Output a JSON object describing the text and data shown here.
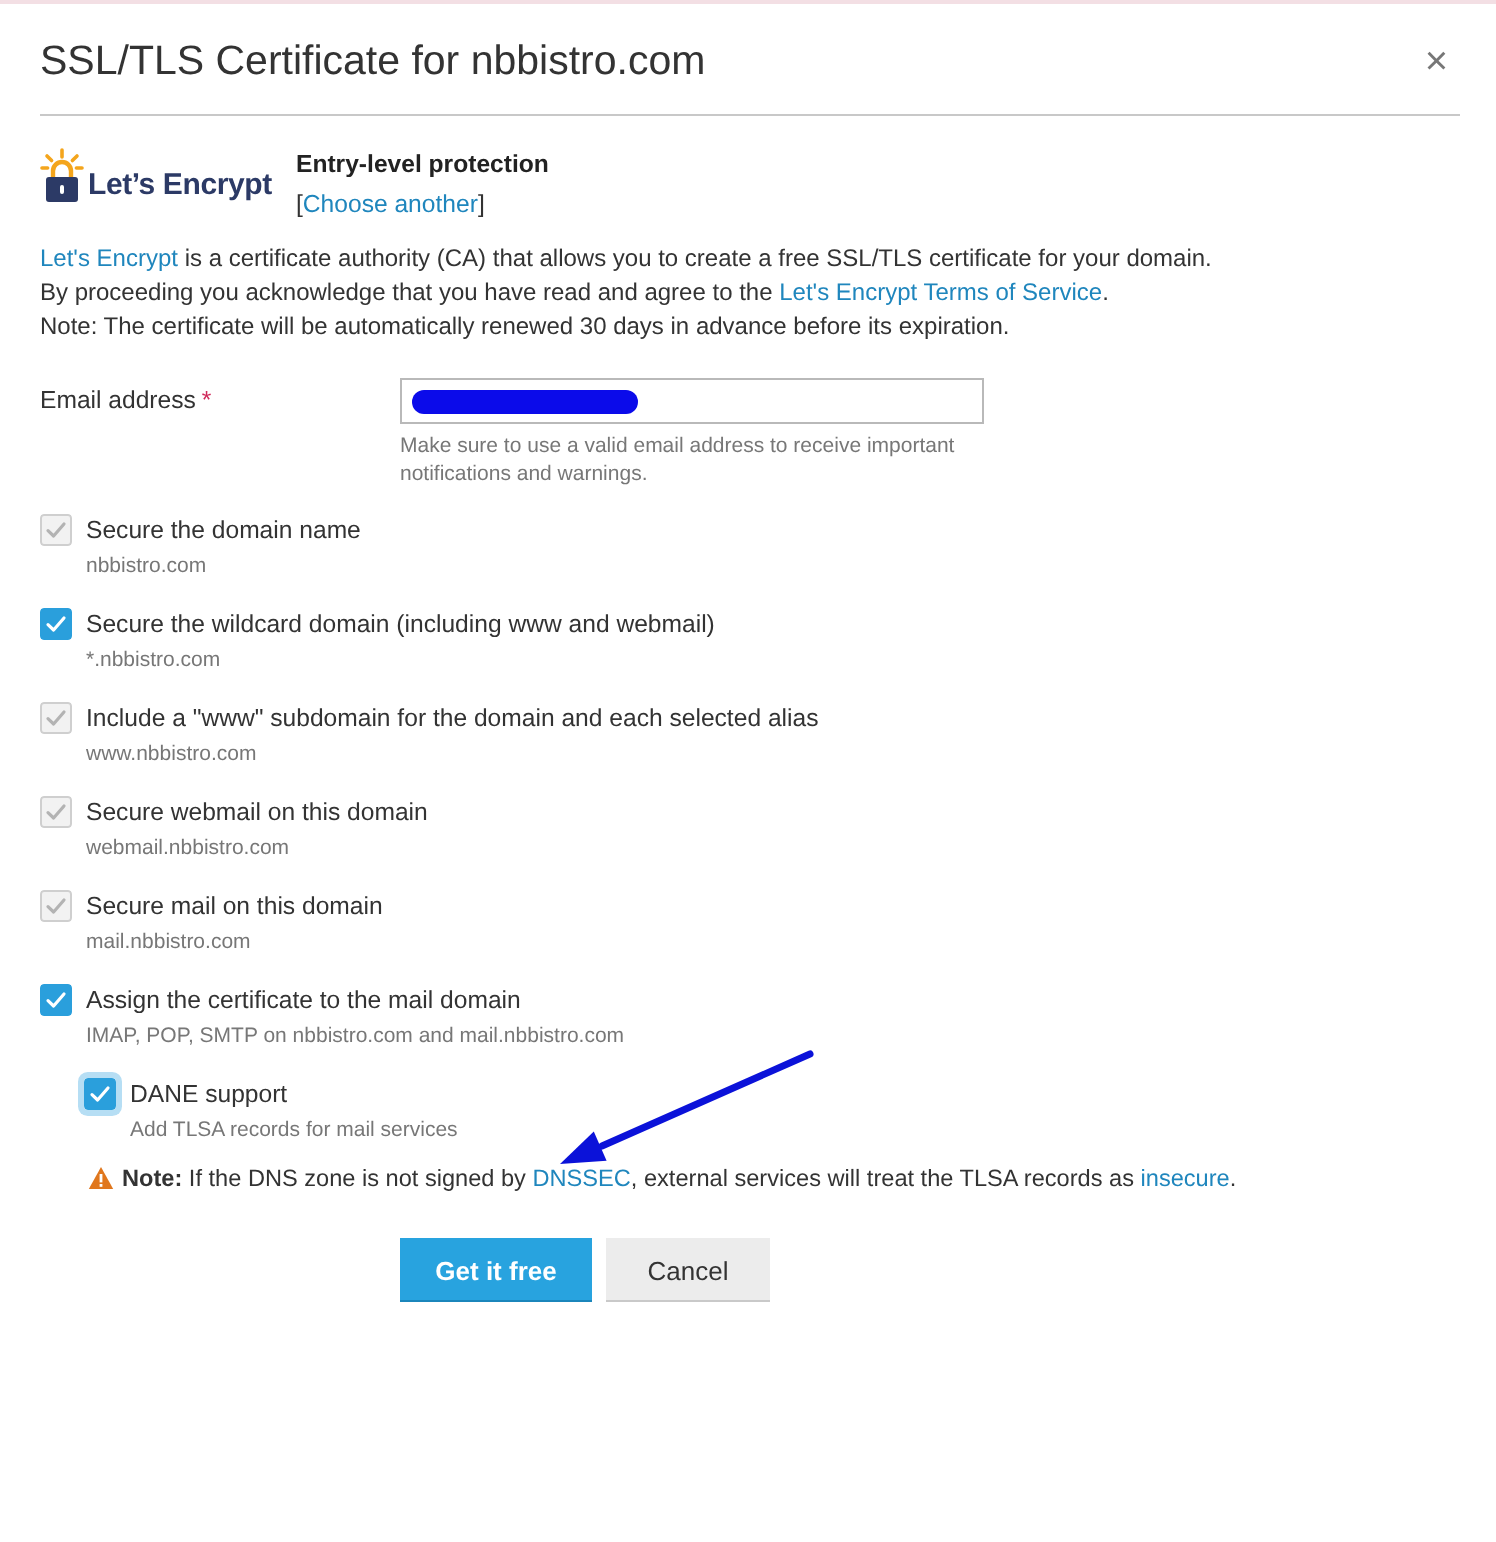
{
  "dialog": {
    "title": "SSL/TLS Certificate for nbbistro.com",
    "close": "×"
  },
  "provider": {
    "logo_text": "Let’s Encrypt",
    "tier": "Entry-level protection",
    "choose": [
      {
        "kind": "text",
        "text": "["
      },
      {
        "kind": "link",
        "text": "Choose another"
      },
      {
        "kind": "text",
        "text": "]"
      }
    ]
  },
  "intro": [
    [
      {
        "kind": "link",
        "text": "Let's Encrypt"
      },
      {
        "kind": "text",
        "text": " is a certificate authority (CA) that allows you to create a free SSL/TLS certificate for your domain."
      }
    ],
    [
      {
        "kind": "text",
        "text": "By proceeding you acknowledge that you have read and agree to the "
      },
      {
        "kind": "link",
        "text": "Let's Encrypt Terms of Service"
      },
      {
        "kind": "text",
        "text": "."
      }
    ],
    [
      {
        "kind": "text",
        "text": "Note: The certificate will be automatically renewed 30 days in advance before its expiration."
      }
    ]
  ],
  "email": {
    "label": "Email address",
    "required_mark": "*",
    "redacted": true,
    "hint": "Make sure to use a valid email address to receive important notifications and warnings."
  },
  "options": [
    {
      "kind": "checkbox",
      "label": "Secure the domain name",
      "hint": "nbbistro.com",
      "checked": true,
      "disabled": true,
      "focused": false
    },
    {
      "kind": "checkbox",
      "label": "Secure the wildcard domain (including www and webmail)",
      "hint": "*.nbbistro.com",
      "checked": true,
      "disabled": false,
      "focused": false
    },
    {
      "kind": "checkbox",
      "label": "Include a \"www\" subdomain for the domain and each selected alias",
      "hint": "www.nbbistro.com",
      "checked": true,
      "disabled": true,
      "focused": false
    },
    {
      "kind": "checkbox",
      "label": "Secure webmail on this domain",
      "hint": "webmail.nbbistro.com",
      "checked": true,
      "disabled": true,
      "focused": false
    },
    {
      "kind": "checkbox",
      "label": "Secure mail on this domain",
      "hint": "mail.nbbistro.com",
      "checked": true,
      "disabled": true,
      "focused": false
    },
    {
      "kind": "checkbox",
      "label": "Assign the certificate to the mail domain",
      "hint": "IMAP, POP, SMTP on nbbistro.com and mail.nbbistro.com",
      "checked": true,
      "disabled": false,
      "focused": false,
      "children": [
        {
          "kind": "checkbox",
          "label": "DANE support",
          "hint": "Add TLSA records for mail services",
          "checked": true,
          "disabled": false,
          "focused": true
        }
      ]
    }
  ],
  "note": [
    {
      "kind": "bold",
      "text": "Note:"
    },
    {
      "kind": "text",
      "text": " If the DNS zone is not signed by "
    },
    {
      "kind": "link",
      "text": "DNSSEC"
    },
    {
      "kind": "text",
      "text": ", external services will treat the TLSA records as "
    },
    {
      "kind": "link",
      "text": "insecure"
    },
    {
      "kind": "text",
      "text": "."
    }
  ],
  "buttons": [
    {
      "kind": "primary",
      "label": "Get it free"
    },
    {
      "kind": "secondary",
      "label": "Cancel"
    }
  ]
}
